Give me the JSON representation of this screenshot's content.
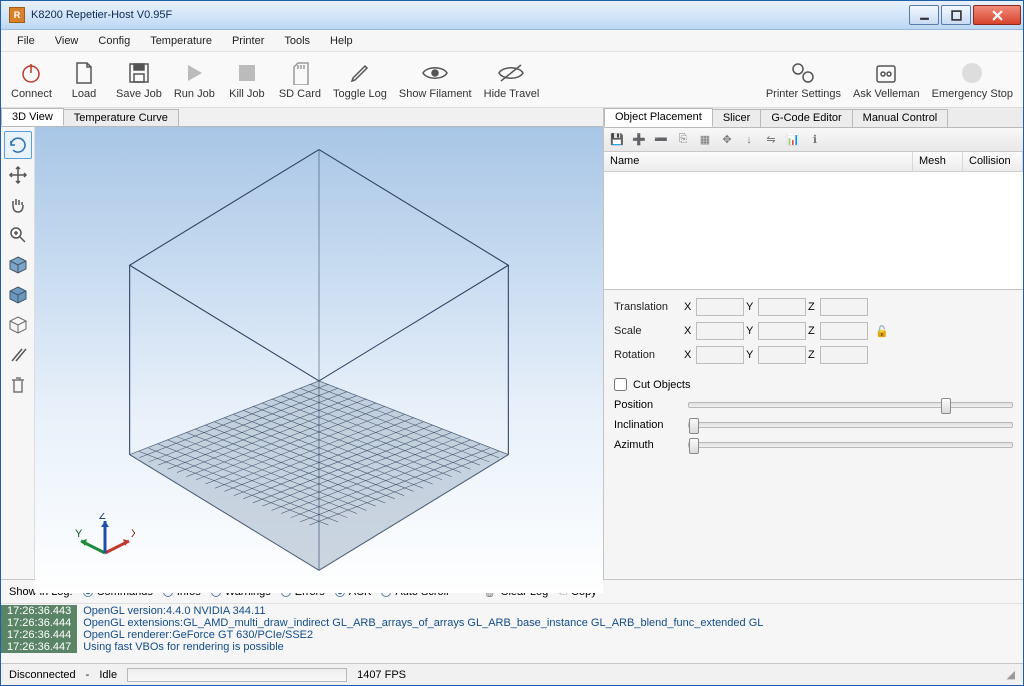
{
  "window": {
    "title": "K8200 Repetier-Host V0.95F",
    "appicon_letter": "R"
  },
  "menu": [
    "File",
    "View",
    "Config",
    "Temperature",
    "Printer",
    "Tools",
    "Help"
  ],
  "toolbar": [
    {
      "id": "connect",
      "label": "Connect"
    },
    {
      "id": "load",
      "label": "Load"
    },
    {
      "id": "save-job",
      "label": "Save Job"
    },
    {
      "id": "run-job",
      "label": "Run Job"
    },
    {
      "id": "kill-job",
      "label": "Kill Job"
    },
    {
      "id": "sd-card",
      "label": "SD Card"
    },
    {
      "id": "toggle-log",
      "label": "Toggle Log"
    },
    {
      "id": "show-filament",
      "label": "Show Filament"
    },
    {
      "id": "hide-travel",
      "label": "Hide Travel"
    }
  ],
  "toolbar_right": [
    {
      "id": "printer-settings",
      "label": "Printer Settings"
    },
    {
      "id": "ask-velleman",
      "label": "Ask Velleman"
    },
    {
      "id": "emergency-stop",
      "label": "Emergency Stop"
    }
  ],
  "view_tabs": {
    "active": "3D View",
    "other": "Temperature Curve"
  },
  "right_tabs": [
    "Object Placement",
    "Slicer",
    "G-Code Editor",
    "Manual Control"
  ],
  "right_tabs_active": 0,
  "object_list": {
    "cols": [
      "Name",
      "Mesh",
      "Collision"
    ]
  },
  "transform": {
    "rows": [
      "Translation",
      "Scale",
      "Rotation"
    ],
    "axes": [
      "X",
      "Y",
      "Z"
    ]
  },
  "cut": {
    "checkbox": "Cut Objects",
    "sliders": [
      "Position",
      "Inclination",
      "Azimuth"
    ],
    "position_thumb_pct": 78,
    "inclination_thumb_pct": 0,
    "azimuth_thumb_pct": 0
  },
  "log_toolbar": {
    "label": "Show in Log:",
    "items": [
      {
        "label": "Commands",
        "on": true
      },
      {
        "label": "Infos",
        "on": false
      },
      {
        "label": "Warnings",
        "on": false
      },
      {
        "label": "Errors",
        "on": false
      },
      {
        "label": "ACK",
        "on": true
      },
      {
        "label": "Auto Scroll",
        "on": false
      }
    ],
    "clear": "Clear Log",
    "copy": "Copy"
  },
  "log_lines": [
    {
      "ts": "17:26:36.443",
      "msg": "OpenGL version:4.4.0 NVIDIA 344.11"
    },
    {
      "ts": "17:26:36.444",
      "msg": "OpenGL extensions:GL_AMD_multi_draw_indirect GL_ARB_arrays_of_arrays GL_ARB_base_instance GL_ARB_blend_func_extended GL"
    },
    {
      "ts": "17:26:36.444",
      "msg": "OpenGL renderer:GeForce GT 630/PCIe/SSE2"
    },
    {
      "ts": "17:26:36.447",
      "msg": "Using fast VBOs for rendering is possible"
    }
  ],
  "status": {
    "connection": "Disconnected",
    "sep": "-",
    "state": "Idle",
    "fps": "1407 FPS"
  }
}
